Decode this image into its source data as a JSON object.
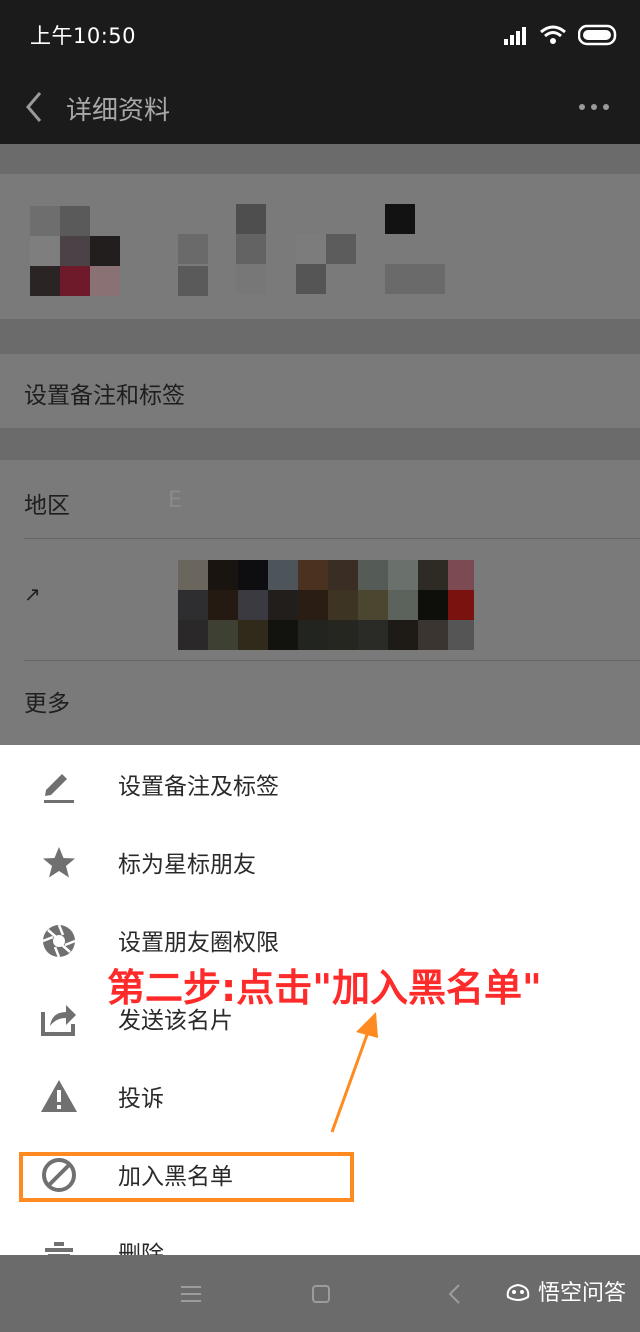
{
  "status_bar": {
    "time": "上午10:50"
  },
  "titlebar": {
    "title": "详细资料"
  },
  "profile": {
    "remark_row": "设置备注和标签",
    "region_label": "地区",
    "region_value": "E",
    "photo_label": "↗",
    "more_label": "更多"
  },
  "sheet": {
    "items": [
      {
        "label": "设置备注及标签",
        "icon": "pencil-icon"
      },
      {
        "label": "标为星标朋友",
        "icon": "star-icon"
      },
      {
        "label": "设置朋友圈权限",
        "icon": "aperture-icon"
      },
      {
        "label": "发送该名片",
        "icon": "share-icon"
      },
      {
        "label": "投诉",
        "icon": "warning-icon"
      },
      {
        "label": "加入黑名单",
        "icon": "block-icon"
      },
      {
        "label": "删除",
        "icon": "trash-icon"
      }
    ]
  },
  "annotation": {
    "text": "第二步:点击\"加入黑名单\"",
    "color": "#ff2a2a",
    "box_color": "#ff8a20"
  },
  "watermark": {
    "text": "悟空问答"
  }
}
